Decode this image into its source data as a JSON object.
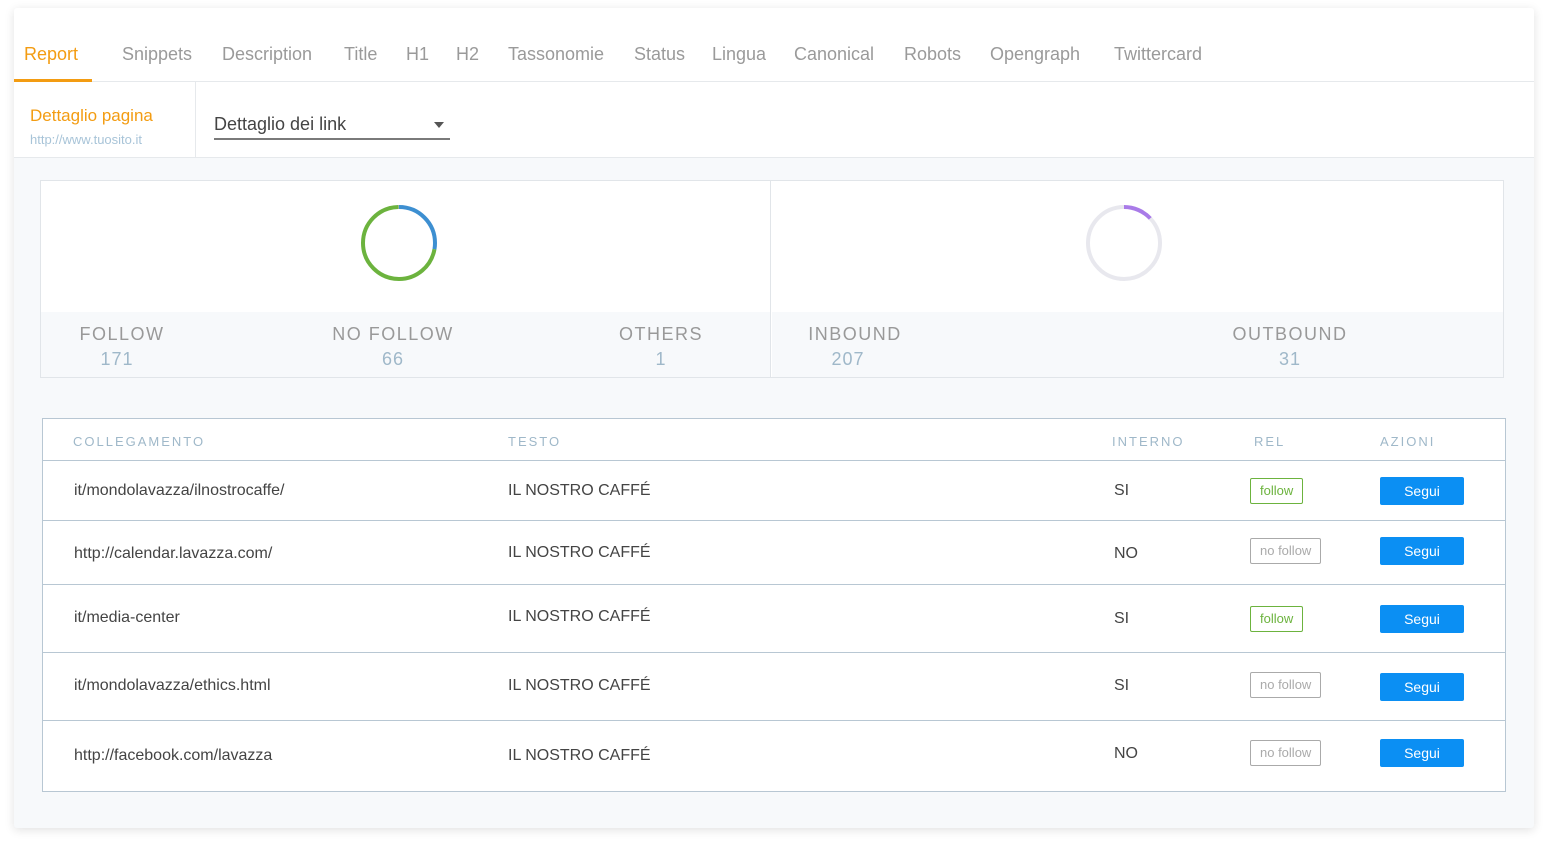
{
  "tabs": [
    {
      "label": "Report",
      "active": true
    },
    {
      "label": "Snippets"
    },
    {
      "label": "Description"
    },
    {
      "label": "Title"
    },
    {
      "label": "H1"
    },
    {
      "label": "H2"
    },
    {
      "label": "Tassonomie"
    },
    {
      "label": "Status"
    },
    {
      "label": "Lingua"
    },
    {
      "label": "Canonical"
    },
    {
      "label": "Robots"
    },
    {
      "label": "Opengraph"
    },
    {
      "label": "Twittercard"
    }
  ],
  "page_detail": {
    "title": "Dettaglio pagina",
    "url": "http://www.tuosito.it"
  },
  "detail_select": {
    "value": "Dettaglio dei link"
  },
  "rel_stats": {
    "items": [
      {
        "label": "FOLLOW",
        "value": "171"
      },
      {
        "label": "NO FOLLOW",
        "value": "66"
      },
      {
        "label": "OTHERS",
        "value": "1"
      }
    ],
    "colors": {
      "follow": "#6cb33e",
      "nofollow": "#3d8fd1",
      "others": "#b0b0b0"
    }
  },
  "direction_stats": {
    "items": [
      {
        "label": "INBOUND",
        "value": "207"
      },
      {
        "label": "OUTBOUND",
        "value": "31"
      }
    ],
    "colors": {
      "inbound": "#e8e8ee",
      "outbound": "#a97be8"
    }
  },
  "table": {
    "headers": {
      "link": "COLLEGAMENTO",
      "text": "TESTO",
      "internal": "INTERNO",
      "rel": "REL",
      "actions": "AZIONI"
    },
    "rows": [
      {
        "link": "it/mondolavazza/ilnostrocaffe/",
        "text": "IL NOSTRO CAFFÉ",
        "internal": "SI",
        "rel": "follow",
        "action": "Segui"
      },
      {
        "link": "http://calendar.lavazza.com/",
        "text": "IL NOSTRO CAFFÉ",
        "internal": "NO",
        "rel": "no follow",
        "action": "Segui"
      },
      {
        "link": "it/media-center",
        "text": "IL NOSTRO CAFFÉ",
        "internal": "SI",
        "rel": "follow",
        "action": "Segui"
      },
      {
        "link": "it/mondolavazza/ethics.html",
        "text": "IL NOSTRO CAFFÉ",
        "internal": "SI",
        "rel": "no follow",
        "action": "Segui"
      },
      {
        "link": "http://facebook.com/lavazza",
        "text": "IL NOSTRO CAFFÉ",
        "internal": "NO",
        "rel": "no follow",
        "action": "Segui"
      }
    ]
  }
}
